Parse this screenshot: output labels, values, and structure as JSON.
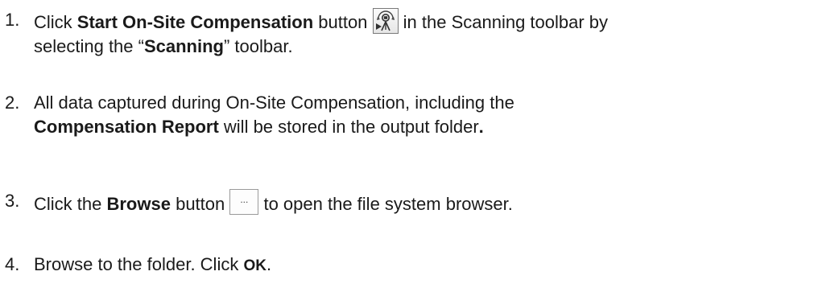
{
  "steps": [
    {
      "number": "1.",
      "text_click": "Click ",
      "bold_start": "Start On-Site Compensation",
      "text_button": " button ",
      "icon": "scanner-compensation-icon",
      "text_rest": " in the Scanning toolbar by",
      "line2_a": "selecting the “",
      "bold_scanning": "Scanning",
      "line2_b": "” toolbar."
    },
    {
      "number": "2.",
      "line1": "All data captured during On-Site Compensation, including the",
      "bold_report": "Compensation Report",
      "line2_rest": " will be stored in the output folder",
      "bold_period": "."
    },
    {
      "number": "3.",
      "text_click": "Click the ",
      "bold_browse": "Browse",
      "text_button": " button ",
      "browse_button_label": "...",
      "text_rest": " to open the file system browser."
    },
    {
      "number": "4.",
      "text": "Browse to the folder. Click ",
      "bold_ok": "OK",
      "period": "."
    }
  ]
}
